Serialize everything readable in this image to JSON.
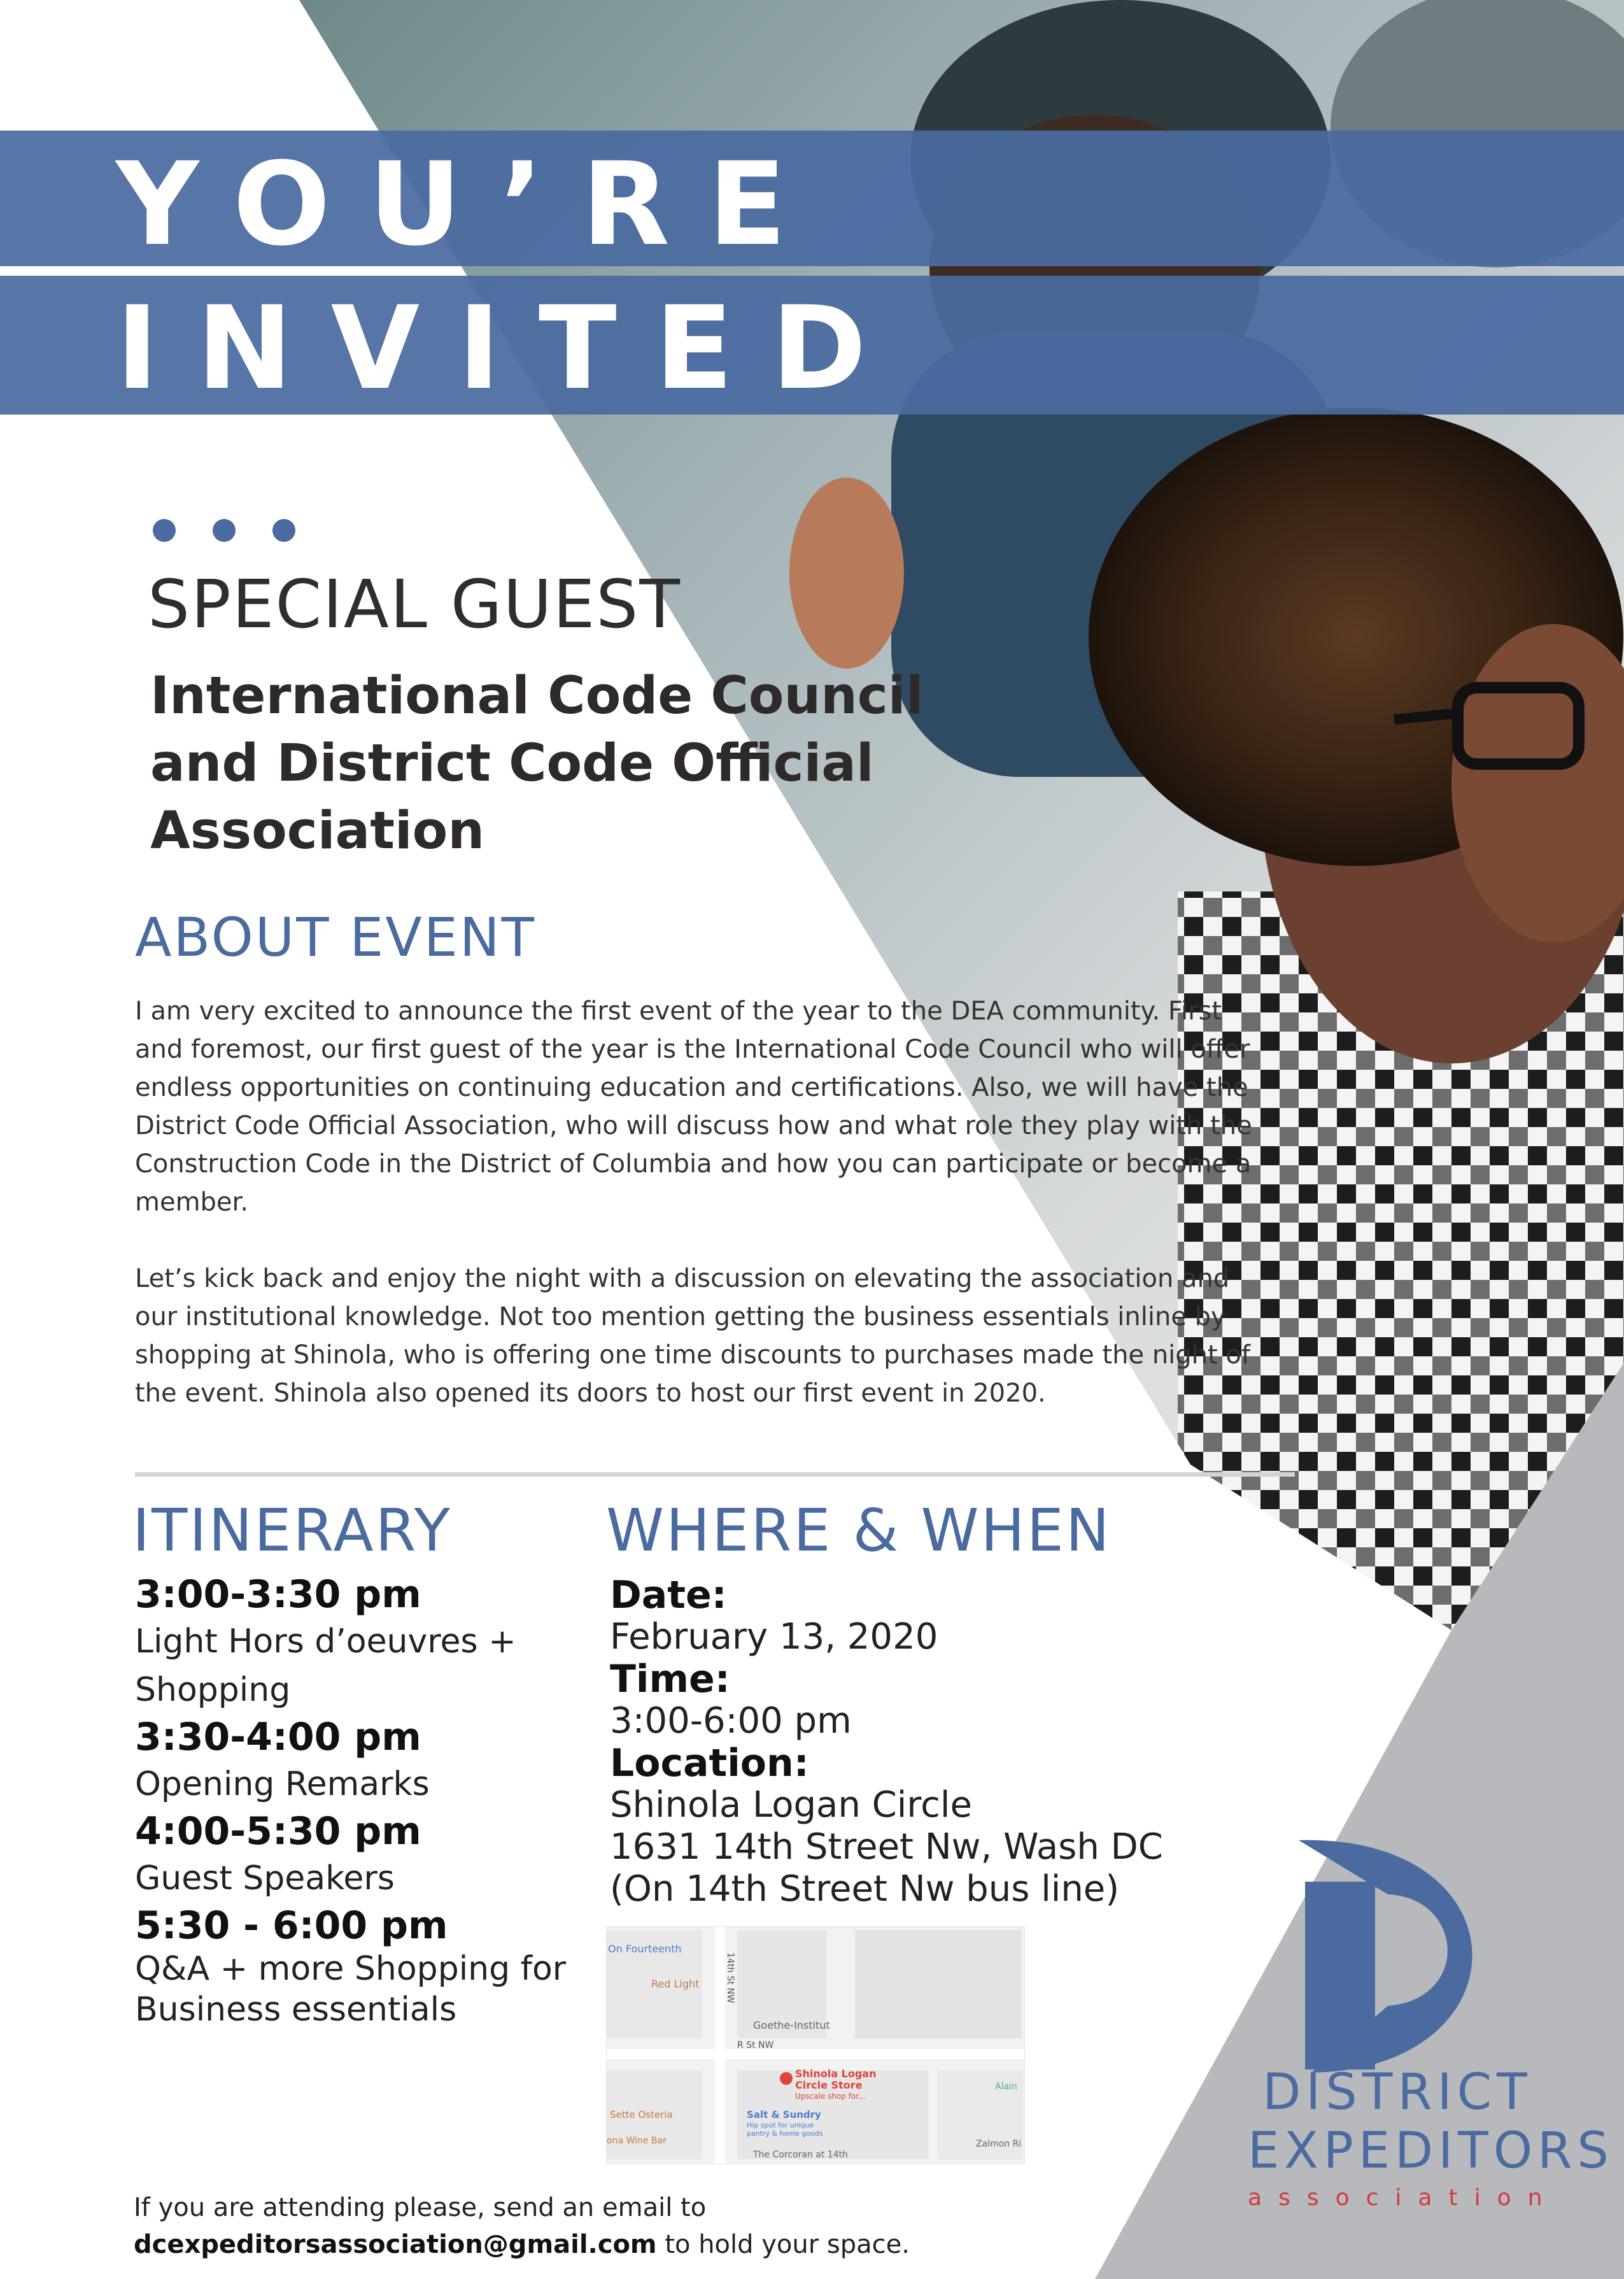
{
  "banner": {
    "line1": "YOU’RE",
    "line2": "INVITED"
  },
  "special_guest": {
    "heading": "SPECIAL GUEST",
    "name": "International Code Council and District Code Official Association"
  },
  "about": {
    "heading": "ABOUT EVENT",
    "paragraphs": [
      "I am very excited to announce the first event of the year to the DEA community. First and foremost, our first guest of the year is the International Code Council who will offer endless opportunities on continuing education and certifications.  Also, we will have the District Code Official Association, who will discuss how and what role they play with the Construction Code in the District of Columbia and how you can participate or become a member.",
      "Let’s kick back and enjoy the night with a discussion on elevating the association and our institutional knowledge.  Not too mention getting the business essentials inline by shopping at Shinola, who is offering one time discounts to purchases made the night of the event.   Shinola also opened its doors to host our first event in 2020."
    ]
  },
  "itinerary": {
    "heading": "ITINERARY",
    "items": [
      {
        "time": "3:00-3:30 pm",
        "desc": "Light Hors d’oeuvres + Shopping"
      },
      {
        "time": "3:30-4:00 pm",
        "desc": "Opening Remarks"
      },
      {
        "time": "4:00-5:30 pm",
        "desc": "Guest Speakers"
      },
      {
        "time": "5:30 - 6:00 pm",
        "desc": "Q&A + more Shopping for Business essentials"
      }
    ]
  },
  "where_when": {
    "heading": "WHERE & WHEN",
    "date_label": "Date:",
    "date": "February 13, 2020",
    "time_label": "Time:",
    "time": "3:00-6:00 pm",
    "location_label": "Location:",
    "location_name": "Shinola Logan Circle",
    "address": "1631 14th Street Nw, Wash DC",
    "transit_note": "(On 14th Street Nw bus line)"
  },
  "map": {
    "labels": {
      "on_fourteenth": "On Fourteenth",
      "red_light": "Red Light",
      "street_14th": "14th St NW",
      "goethe": "Goethe-Institut",
      "r_st": "R St NW",
      "shinola_1": "Shinola Logan",
      "shinola_2": "Circle Store",
      "shinola_sub": "Upscale shop for...",
      "alain": "Alain",
      "sette": "Sette Osteria",
      "salt_sundry": "Salt & Sundry",
      "salt_sub1": "Hip spot for unique",
      "salt_sub2": "pantry & home goods",
      "wine_bar": "ona Wine Bar",
      "zalmon": "Zalmon Ri",
      "corcoran": "The Corcoran at 14th"
    }
  },
  "footer": {
    "line1": "If you are attending please, send an email to",
    "email": "dcexpeditorsassociation@gmail.com",
    "line2_rest": " to hold your space."
  },
  "logo": {
    "line1": "DISTRICT",
    "line2": "EXPEDITORS",
    "line3": "association"
  },
  "colors": {
    "brand_blue": "#4a6aa0",
    "accent_red": "#d23b3b",
    "gray_panel": "#b8b9bd"
  }
}
